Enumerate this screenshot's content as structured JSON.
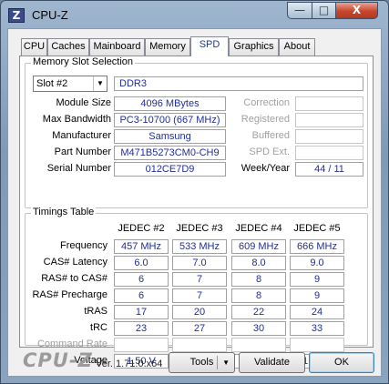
{
  "window": {
    "title": "CPU-Z",
    "icon_glyph": "Z",
    "controls": {
      "minimize": "—",
      "maximize": "□",
      "close": "X"
    }
  },
  "tabs": [
    {
      "label": "CPU"
    },
    {
      "label": "Caches"
    },
    {
      "label": "Mainboard"
    },
    {
      "label": "Memory"
    },
    {
      "label": "SPD",
      "active": true
    },
    {
      "label": "Graphics"
    },
    {
      "label": "About"
    }
  ],
  "slot": {
    "group_title": "Memory Slot Selection",
    "selected": "Slot #2",
    "type": "DDR3",
    "fields": {
      "module_size": {
        "label": "Module Size",
        "value": "4096 MBytes"
      },
      "max_bandwidth": {
        "label": "Max Bandwidth",
        "value": "PC3-10700 (667 MHz)"
      },
      "manufacturer": {
        "label": "Manufacturer",
        "value": "Samsung"
      },
      "part_number": {
        "label": "Part Number",
        "value": "M471B5273CM0-CH9"
      },
      "serial_number": {
        "label": "Serial Number",
        "value": "012CE7D9"
      }
    },
    "right": {
      "correction": {
        "label": "Correction",
        "value": ""
      },
      "registered": {
        "label": "Registered",
        "value": ""
      },
      "buffered": {
        "label": "Buffered",
        "value": ""
      },
      "spd_ext": {
        "label": "SPD Ext.",
        "value": ""
      },
      "week_year": {
        "label": "Week/Year",
        "value": "44 / 11"
      }
    }
  },
  "timings": {
    "group_title": "Timings Table",
    "columns": [
      "JEDEC #2",
      "JEDEC #3",
      "JEDEC #4",
      "JEDEC #5"
    ],
    "rows": [
      {
        "label": "Frequency",
        "values": [
          "457 MHz",
          "533 MHz",
          "609 MHz",
          "666 MHz"
        ]
      },
      {
        "label": "CAS# Latency",
        "values": [
          "6.0",
          "7.0",
          "8.0",
          "9.0"
        ]
      },
      {
        "label": "RAS# to CAS#",
        "values": [
          "6",
          "7",
          "8",
          "9"
        ]
      },
      {
        "label": "RAS# Precharge",
        "values": [
          "6",
          "7",
          "8",
          "9"
        ]
      },
      {
        "label": "tRAS",
        "values": [
          "17",
          "20",
          "22",
          "24"
        ]
      },
      {
        "label": "tRC",
        "values": [
          "23",
          "27",
          "30",
          "33"
        ]
      },
      {
        "label": "Command Rate",
        "values": [
          "",
          "",
          "",
          ""
        ],
        "disabled": true
      },
      {
        "label": "Voltage",
        "values": [
          "1.50 V",
          "1.50 V",
          "1.50 V",
          "1.50 V"
        ]
      }
    ]
  },
  "footer": {
    "brand": "CPU-Z",
    "version": "Ver. 1.71.0.x64",
    "tools": "Tools",
    "validate": "Validate",
    "ok": "OK"
  },
  "colors": {
    "value_text": "#1f2e9c",
    "tab_active_text": "#1a3a8a",
    "close_button": "#c8452d"
  }
}
